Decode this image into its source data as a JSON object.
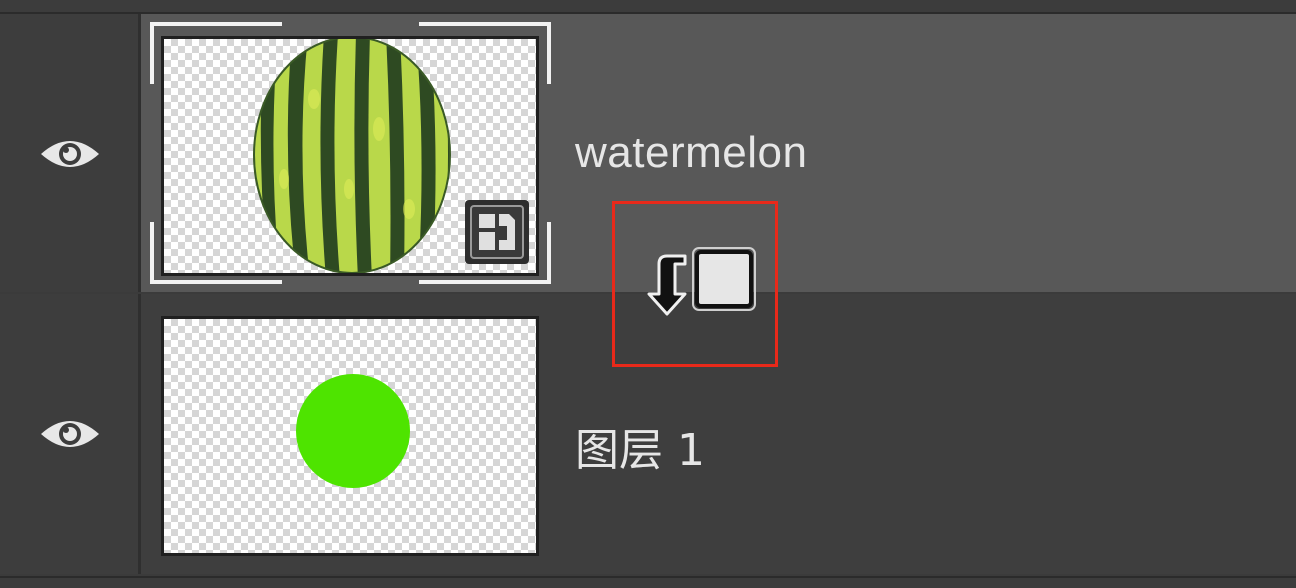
{
  "layers": [
    {
      "name": "watermelon",
      "visible": true,
      "selected": true,
      "type": "smart-object",
      "thumbnail_icon": "watermelon-image"
    },
    {
      "name": "图层 1",
      "visible": true,
      "selected": false,
      "type": "pixel",
      "thumbnail_icon": "green-circle-image"
    }
  ],
  "cursor": {
    "icon": "clipping-mask-cursor-icon"
  },
  "colors": {
    "highlight_box": "#e8291a",
    "selected_row": "#585858",
    "unselected_row": "#3e3e3e",
    "green_circle": "#4ee400"
  }
}
